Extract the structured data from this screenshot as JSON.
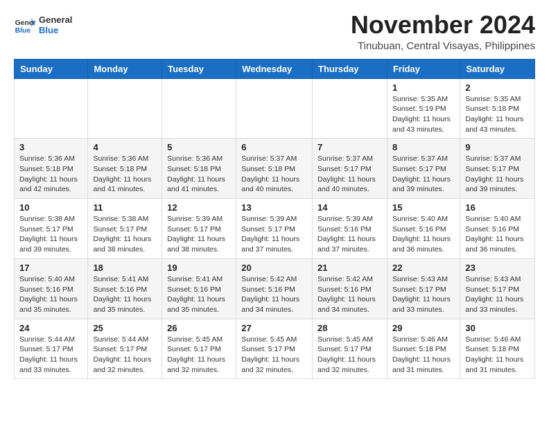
{
  "logo": {
    "text_general": "General",
    "text_blue": "Blue"
  },
  "title": "November 2024",
  "location": "Tinubuan, Central Visayas, Philippines",
  "days_of_week": [
    "Sunday",
    "Monday",
    "Tuesday",
    "Wednesday",
    "Thursday",
    "Friday",
    "Saturday"
  ],
  "weeks": [
    [
      {
        "day": "",
        "info": ""
      },
      {
        "day": "",
        "info": ""
      },
      {
        "day": "",
        "info": ""
      },
      {
        "day": "",
        "info": ""
      },
      {
        "day": "",
        "info": ""
      },
      {
        "day": "1",
        "info": "Sunrise: 5:35 AM\nSunset: 5:19 PM\nDaylight: 11 hours and 43 minutes."
      },
      {
        "day": "2",
        "info": "Sunrise: 5:35 AM\nSunset: 5:18 PM\nDaylight: 11 hours and 43 minutes."
      }
    ],
    [
      {
        "day": "3",
        "info": "Sunrise: 5:36 AM\nSunset: 5:18 PM\nDaylight: 11 hours and 42 minutes."
      },
      {
        "day": "4",
        "info": "Sunrise: 5:36 AM\nSunset: 5:18 PM\nDaylight: 11 hours and 41 minutes."
      },
      {
        "day": "5",
        "info": "Sunrise: 5:36 AM\nSunset: 5:18 PM\nDaylight: 11 hours and 41 minutes."
      },
      {
        "day": "6",
        "info": "Sunrise: 5:37 AM\nSunset: 5:18 PM\nDaylight: 11 hours and 40 minutes."
      },
      {
        "day": "7",
        "info": "Sunrise: 5:37 AM\nSunset: 5:17 PM\nDaylight: 11 hours and 40 minutes."
      },
      {
        "day": "8",
        "info": "Sunrise: 5:37 AM\nSunset: 5:17 PM\nDaylight: 11 hours and 39 minutes."
      },
      {
        "day": "9",
        "info": "Sunrise: 5:37 AM\nSunset: 5:17 PM\nDaylight: 11 hours and 39 minutes."
      }
    ],
    [
      {
        "day": "10",
        "info": "Sunrise: 5:38 AM\nSunset: 5:17 PM\nDaylight: 11 hours and 39 minutes."
      },
      {
        "day": "11",
        "info": "Sunrise: 5:38 AM\nSunset: 5:17 PM\nDaylight: 11 hours and 38 minutes."
      },
      {
        "day": "12",
        "info": "Sunrise: 5:39 AM\nSunset: 5:17 PM\nDaylight: 11 hours and 38 minutes."
      },
      {
        "day": "13",
        "info": "Sunrise: 5:39 AM\nSunset: 5:17 PM\nDaylight: 11 hours and 37 minutes."
      },
      {
        "day": "14",
        "info": "Sunrise: 5:39 AM\nSunset: 5:16 PM\nDaylight: 11 hours and 37 minutes."
      },
      {
        "day": "15",
        "info": "Sunrise: 5:40 AM\nSunset: 5:16 PM\nDaylight: 11 hours and 36 minutes."
      },
      {
        "day": "16",
        "info": "Sunrise: 5:40 AM\nSunset: 5:16 PM\nDaylight: 11 hours and 36 minutes."
      }
    ],
    [
      {
        "day": "17",
        "info": "Sunrise: 5:40 AM\nSunset: 5:16 PM\nDaylight: 11 hours and 35 minutes."
      },
      {
        "day": "18",
        "info": "Sunrise: 5:41 AM\nSunset: 5:16 PM\nDaylight: 11 hours and 35 minutes."
      },
      {
        "day": "19",
        "info": "Sunrise: 5:41 AM\nSunset: 5:16 PM\nDaylight: 11 hours and 35 minutes."
      },
      {
        "day": "20",
        "info": "Sunrise: 5:42 AM\nSunset: 5:16 PM\nDaylight: 11 hours and 34 minutes."
      },
      {
        "day": "21",
        "info": "Sunrise: 5:42 AM\nSunset: 5:16 PM\nDaylight: 11 hours and 34 minutes."
      },
      {
        "day": "22",
        "info": "Sunrise: 5:43 AM\nSunset: 5:17 PM\nDaylight: 11 hours and 33 minutes."
      },
      {
        "day": "23",
        "info": "Sunrise: 5:43 AM\nSunset: 5:17 PM\nDaylight: 11 hours and 33 minutes."
      }
    ],
    [
      {
        "day": "24",
        "info": "Sunrise: 5:44 AM\nSunset: 5:17 PM\nDaylight: 11 hours and 33 minutes."
      },
      {
        "day": "25",
        "info": "Sunrise: 5:44 AM\nSunset: 5:17 PM\nDaylight: 11 hours and 32 minutes."
      },
      {
        "day": "26",
        "info": "Sunrise: 5:45 AM\nSunset: 5:17 PM\nDaylight: 11 hours and 32 minutes."
      },
      {
        "day": "27",
        "info": "Sunrise: 5:45 AM\nSunset: 5:17 PM\nDaylight: 11 hours and 32 minutes."
      },
      {
        "day": "28",
        "info": "Sunrise: 5:45 AM\nSunset: 5:17 PM\nDaylight: 11 hours and 32 minutes."
      },
      {
        "day": "29",
        "info": "Sunrise: 5:46 AM\nSunset: 5:18 PM\nDaylight: 11 hours and 31 minutes."
      },
      {
        "day": "30",
        "info": "Sunrise: 5:46 AM\nSunset: 5:18 PM\nDaylight: 11 hours and 31 minutes."
      }
    ]
  ]
}
